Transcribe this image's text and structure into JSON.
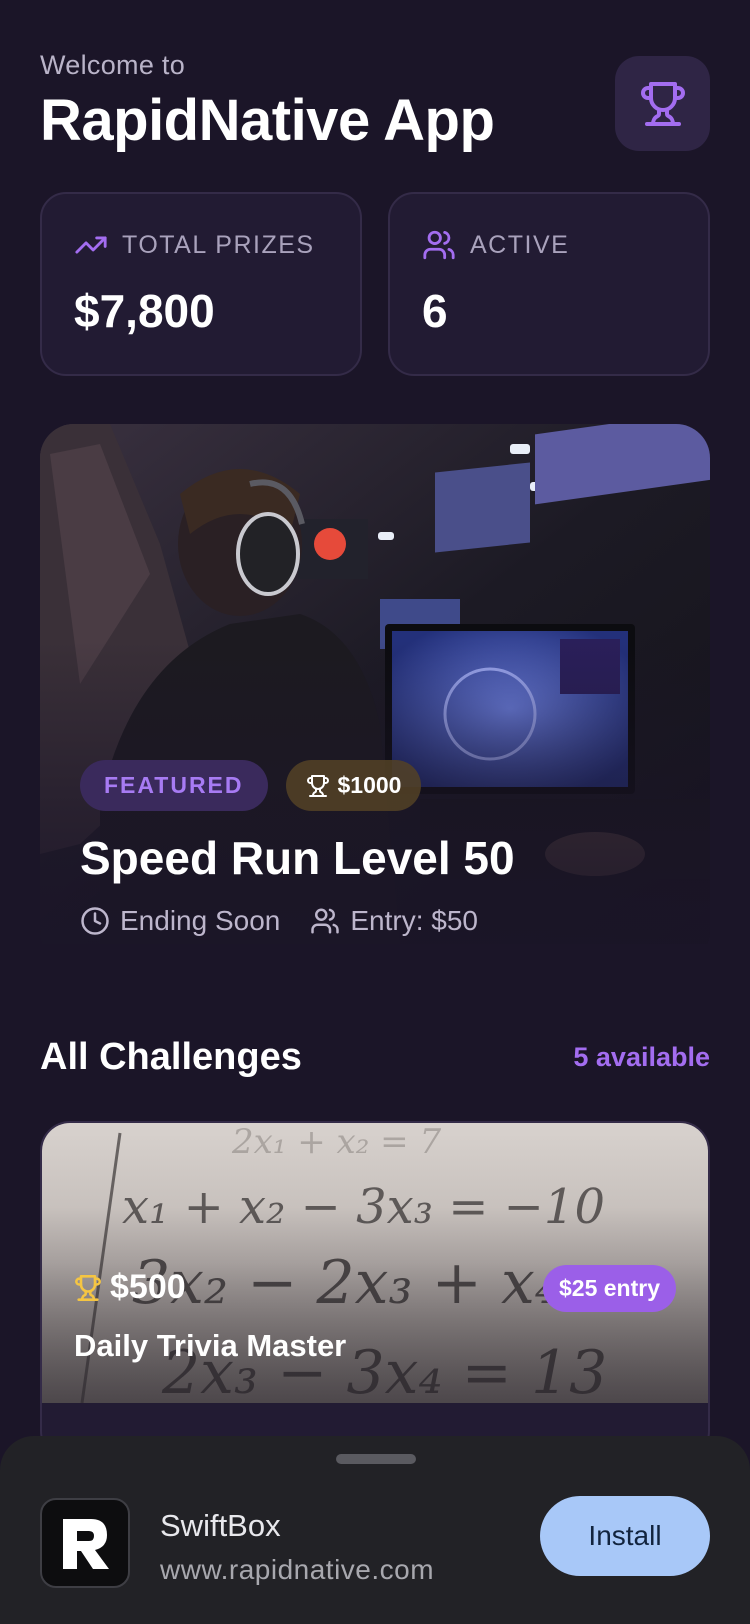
{
  "header": {
    "welcome": "Welcome to",
    "title": "RapidNative App",
    "trophy_icon": "trophy-icon"
  },
  "stats": [
    {
      "label": "TOTAL PRIZES",
      "value": "$7,800",
      "icon": "trending-up-icon"
    },
    {
      "label": "ACTIVE",
      "value": "6",
      "icon": "users-icon"
    }
  ],
  "featured": {
    "badge": "FEATURED",
    "prize": "$1000",
    "title": "Speed Run Level 50",
    "status": "Ending Soon",
    "entry": "Entry: $50"
  },
  "challenges": {
    "title": "All Challenges",
    "count": "5 available",
    "items": [
      {
        "prize": "$500",
        "entry": "$25 entry",
        "title": "Daily Trivia Master"
      }
    ]
  },
  "install_sheet": {
    "app_name": "SwiftBox",
    "url": "www.rapidnative.com",
    "button": "Install"
  },
  "colors": {
    "background": "#1b1528",
    "accent": "#a36df0",
    "card": "#221b33",
    "gold": "#f5c542",
    "install": "#a8c8f8"
  }
}
